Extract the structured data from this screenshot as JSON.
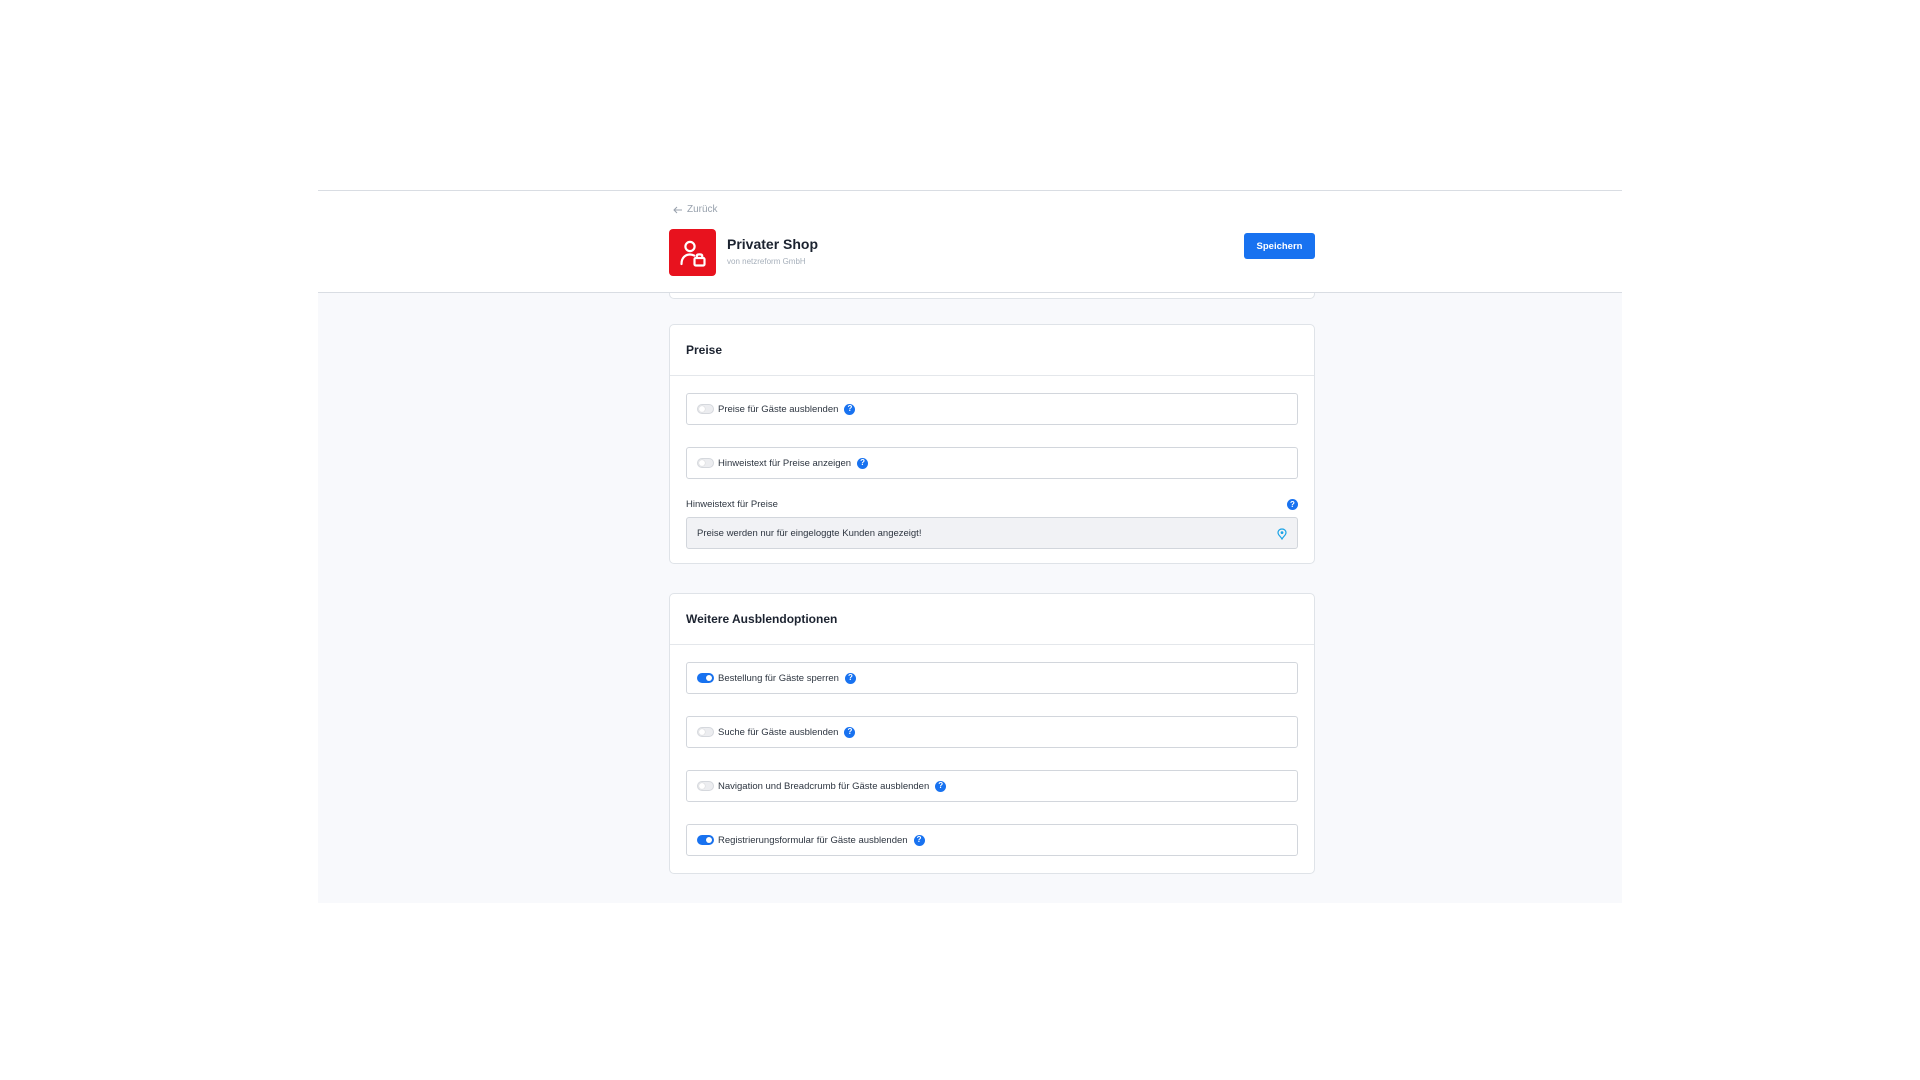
{
  "header": {
    "back_label": "Zurück",
    "app_title": "Privater Shop",
    "app_vendor": "von netzreform GmbH",
    "save_label": "Speichern"
  },
  "prices": {
    "title": "Preise",
    "toggles": [
      {
        "label": "Preise für Gäste ausblenden",
        "enabled": false
      },
      {
        "label": "Hinweistext für Preise anzeigen",
        "enabled": false
      }
    ],
    "hint_field": {
      "label": "Hinweistext für Preise",
      "value": "Preise werden nur für eingeloggte Kunden angezeigt!"
    }
  },
  "more_options": {
    "title": "Weitere Ausblendoptionen",
    "toggles": [
      {
        "label": "Bestellung für Gäste sperren",
        "enabled": true
      },
      {
        "label": "Suche für Gäste ausblenden",
        "enabled": false
      },
      {
        "label": "Navigation und Breadcrumb für Gäste ausblenden",
        "enabled": false
      },
      {
        "label": "Registrierungsformular für Gäste ausblenden",
        "enabled": true
      }
    ]
  },
  "icons": {
    "help": "?",
    "app": "user-lock-icon",
    "back": "arrow-left-icon",
    "translate": "translate-icon"
  },
  "colors": {
    "accent": "#1872f0",
    "app_icon_bg": "#e8121e",
    "content_bg": "#f8f9fc"
  }
}
